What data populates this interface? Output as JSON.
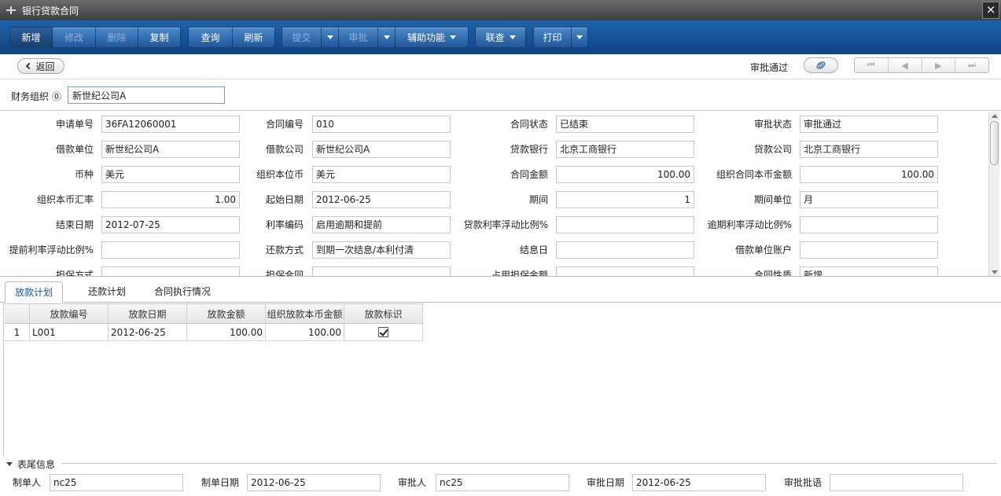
{
  "window": {
    "title": "银行贷款合同",
    "close_label": "×"
  },
  "toolbar": {
    "group1": [
      {
        "label": "新增",
        "state": "active"
      },
      {
        "label": "修改",
        "state": "disabled"
      },
      {
        "label": "删除",
        "state": "disabled"
      },
      {
        "label": "复制",
        "state": "normal"
      }
    ],
    "group2": [
      {
        "label": "查询"
      },
      {
        "label": "刷新"
      }
    ],
    "submit_label": "提交",
    "approve_label": "审批",
    "assist_label": "辅助功能",
    "link_query_label": "联查",
    "print_label": "打印"
  },
  "nav": {
    "back_label": "返回",
    "status": "审批通过",
    "pager": [
      "⏮",
      "◀",
      "▶",
      "⏭"
    ]
  },
  "org": {
    "label": "财务组织 ⓪",
    "value": "新世纪公司A"
  },
  "form": {
    "fields": [
      {
        "label": "申请单号",
        "value": "36FA12060001"
      },
      {
        "label": "合同编号",
        "value": "010"
      },
      {
        "label": "合同状态",
        "value": "已结束"
      },
      {
        "label": "审批状态",
        "value": "审批通过"
      },
      {
        "label": "借款单位",
        "value": "新世纪公司A"
      },
      {
        "label": "借款公司",
        "value": "新世纪公司A"
      },
      {
        "label": "贷款银行",
        "value": "北京工商银行"
      },
      {
        "label": "贷款公司",
        "value": "北京工商银行"
      },
      {
        "label": "币种",
        "value": "美元"
      },
      {
        "label": "组织本位币",
        "value": "美元"
      },
      {
        "label": "合同金额",
        "value": "100.00"
      },
      {
        "label": "组织合同本币金额",
        "value": "100.00"
      },
      {
        "label": "组织本币汇率",
        "value": "1.00"
      },
      {
        "label": "起始日期",
        "value": "2012-06-25"
      },
      {
        "label": "期间",
        "value": "1"
      },
      {
        "label": "期间单位",
        "value": "月"
      },
      {
        "label": "结束日期",
        "value": "2012-07-25"
      },
      {
        "label": "利率编码",
        "value": "启用逾期和提前"
      },
      {
        "label": "贷款利率浮动比例%",
        "value": ""
      },
      {
        "label": "逾期利率浮动比例%",
        "value": ""
      },
      {
        "label": "提前利率浮动比例%",
        "value": ""
      },
      {
        "label": "还款方式",
        "value": "到期一次结息/本利付清"
      },
      {
        "label": "结息日",
        "value": ""
      },
      {
        "label": "借款单位账户",
        "value": ""
      },
      {
        "label": "担保方式",
        "value": ""
      },
      {
        "label": "担保合同",
        "value": ""
      },
      {
        "label": "占用担保金额",
        "value": ""
      },
      {
        "label": "合同性质",
        "value": "新增"
      }
    ]
  },
  "tabs": [
    {
      "label": "放款计划",
      "active": true
    },
    {
      "label": "还款计划",
      "active": false
    },
    {
      "label": "合同执行情况",
      "active": false
    }
  ],
  "grid": {
    "columns": [
      "",
      "放款编号",
      "放款日期",
      "放款金额",
      "组织放款本币金额",
      "放款标识"
    ],
    "rows": [
      {
        "idx": "1",
        "code": "L001",
        "date": "2012-06-25",
        "amount": "100.00",
        "local_amount": "100.00",
        "flag": true
      }
    ]
  },
  "footer": {
    "title": "表尾信息",
    "fields": [
      {
        "label": "制单人",
        "value": "nc25"
      },
      {
        "label": "制单日期",
        "value": "2012-06-25"
      },
      {
        "label": "审批人",
        "value": "nc25"
      },
      {
        "label": "审批日期",
        "value": "2012-06-25"
      },
      {
        "label": "审批批语",
        "value": ""
      }
    ]
  },
  "colors": {
    "toolbar_top": "#1f63aa",
    "toolbar_bottom": "#0f4385",
    "tab_active": "#1a56a8"
  }
}
